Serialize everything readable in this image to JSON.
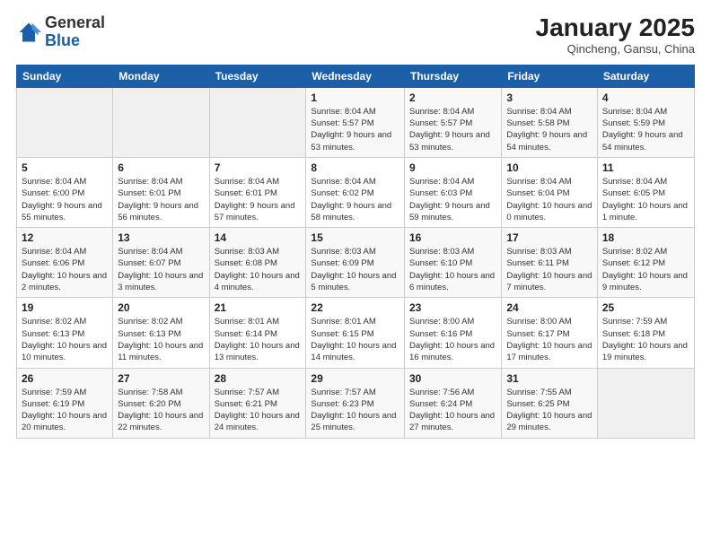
{
  "header": {
    "logo_general": "General",
    "logo_blue": "Blue",
    "month_title": "January 2025",
    "location": "Qincheng, Gansu, China"
  },
  "days_of_week": [
    "Sunday",
    "Monday",
    "Tuesday",
    "Wednesday",
    "Thursday",
    "Friday",
    "Saturday"
  ],
  "weeks": [
    [
      {
        "day": "",
        "info": ""
      },
      {
        "day": "",
        "info": ""
      },
      {
        "day": "",
        "info": ""
      },
      {
        "day": "1",
        "info": "Sunrise: 8:04 AM\nSunset: 5:57 PM\nDaylight: 9 hours and 53 minutes."
      },
      {
        "day": "2",
        "info": "Sunrise: 8:04 AM\nSunset: 5:57 PM\nDaylight: 9 hours and 53 minutes."
      },
      {
        "day": "3",
        "info": "Sunrise: 8:04 AM\nSunset: 5:58 PM\nDaylight: 9 hours and 54 minutes."
      },
      {
        "day": "4",
        "info": "Sunrise: 8:04 AM\nSunset: 5:59 PM\nDaylight: 9 hours and 54 minutes."
      }
    ],
    [
      {
        "day": "5",
        "info": "Sunrise: 8:04 AM\nSunset: 6:00 PM\nDaylight: 9 hours and 55 minutes."
      },
      {
        "day": "6",
        "info": "Sunrise: 8:04 AM\nSunset: 6:01 PM\nDaylight: 9 hours and 56 minutes."
      },
      {
        "day": "7",
        "info": "Sunrise: 8:04 AM\nSunset: 6:01 PM\nDaylight: 9 hours and 57 minutes."
      },
      {
        "day": "8",
        "info": "Sunrise: 8:04 AM\nSunset: 6:02 PM\nDaylight: 9 hours and 58 minutes."
      },
      {
        "day": "9",
        "info": "Sunrise: 8:04 AM\nSunset: 6:03 PM\nDaylight: 9 hours and 59 minutes."
      },
      {
        "day": "10",
        "info": "Sunrise: 8:04 AM\nSunset: 6:04 PM\nDaylight: 10 hours and 0 minutes."
      },
      {
        "day": "11",
        "info": "Sunrise: 8:04 AM\nSunset: 6:05 PM\nDaylight: 10 hours and 1 minute."
      }
    ],
    [
      {
        "day": "12",
        "info": "Sunrise: 8:04 AM\nSunset: 6:06 PM\nDaylight: 10 hours and 2 minutes."
      },
      {
        "day": "13",
        "info": "Sunrise: 8:04 AM\nSunset: 6:07 PM\nDaylight: 10 hours and 3 minutes."
      },
      {
        "day": "14",
        "info": "Sunrise: 8:03 AM\nSunset: 6:08 PM\nDaylight: 10 hours and 4 minutes."
      },
      {
        "day": "15",
        "info": "Sunrise: 8:03 AM\nSunset: 6:09 PM\nDaylight: 10 hours and 5 minutes."
      },
      {
        "day": "16",
        "info": "Sunrise: 8:03 AM\nSunset: 6:10 PM\nDaylight: 10 hours and 6 minutes."
      },
      {
        "day": "17",
        "info": "Sunrise: 8:03 AM\nSunset: 6:11 PM\nDaylight: 10 hours and 7 minutes."
      },
      {
        "day": "18",
        "info": "Sunrise: 8:02 AM\nSunset: 6:12 PM\nDaylight: 10 hours and 9 minutes."
      }
    ],
    [
      {
        "day": "19",
        "info": "Sunrise: 8:02 AM\nSunset: 6:13 PM\nDaylight: 10 hours and 10 minutes."
      },
      {
        "day": "20",
        "info": "Sunrise: 8:02 AM\nSunset: 6:13 PM\nDaylight: 10 hours and 11 minutes."
      },
      {
        "day": "21",
        "info": "Sunrise: 8:01 AM\nSunset: 6:14 PM\nDaylight: 10 hours and 13 minutes."
      },
      {
        "day": "22",
        "info": "Sunrise: 8:01 AM\nSunset: 6:15 PM\nDaylight: 10 hours and 14 minutes."
      },
      {
        "day": "23",
        "info": "Sunrise: 8:00 AM\nSunset: 6:16 PM\nDaylight: 10 hours and 16 minutes."
      },
      {
        "day": "24",
        "info": "Sunrise: 8:00 AM\nSunset: 6:17 PM\nDaylight: 10 hours and 17 minutes."
      },
      {
        "day": "25",
        "info": "Sunrise: 7:59 AM\nSunset: 6:18 PM\nDaylight: 10 hours and 19 minutes."
      }
    ],
    [
      {
        "day": "26",
        "info": "Sunrise: 7:59 AM\nSunset: 6:19 PM\nDaylight: 10 hours and 20 minutes."
      },
      {
        "day": "27",
        "info": "Sunrise: 7:58 AM\nSunset: 6:20 PM\nDaylight: 10 hours and 22 minutes."
      },
      {
        "day": "28",
        "info": "Sunrise: 7:57 AM\nSunset: 6:21 PM\nDaylight: 10 hours and 24 minutes."
      },
      {
        "day": "29",
        "info": "Sunrise: 7:57 AM\nSunset: 6:23 PM\nDaylight: 10 hours and 25 minutes."
      },
      {
        "day": "30",
        "info": "Sunrise: 7:56 AM\nSunset: 6:24 PM\nDaylight: 10 hours and 27 minutes."
      },
      {
        "day": "31",
        "info": "Sunrise: 7:55 AM\nSunset: 6:25 PM\nDaylight: 10 hours and 29 minutes."
      },
      {
        "day": "",
        "info": ""
      }
    ]
  ]
}
